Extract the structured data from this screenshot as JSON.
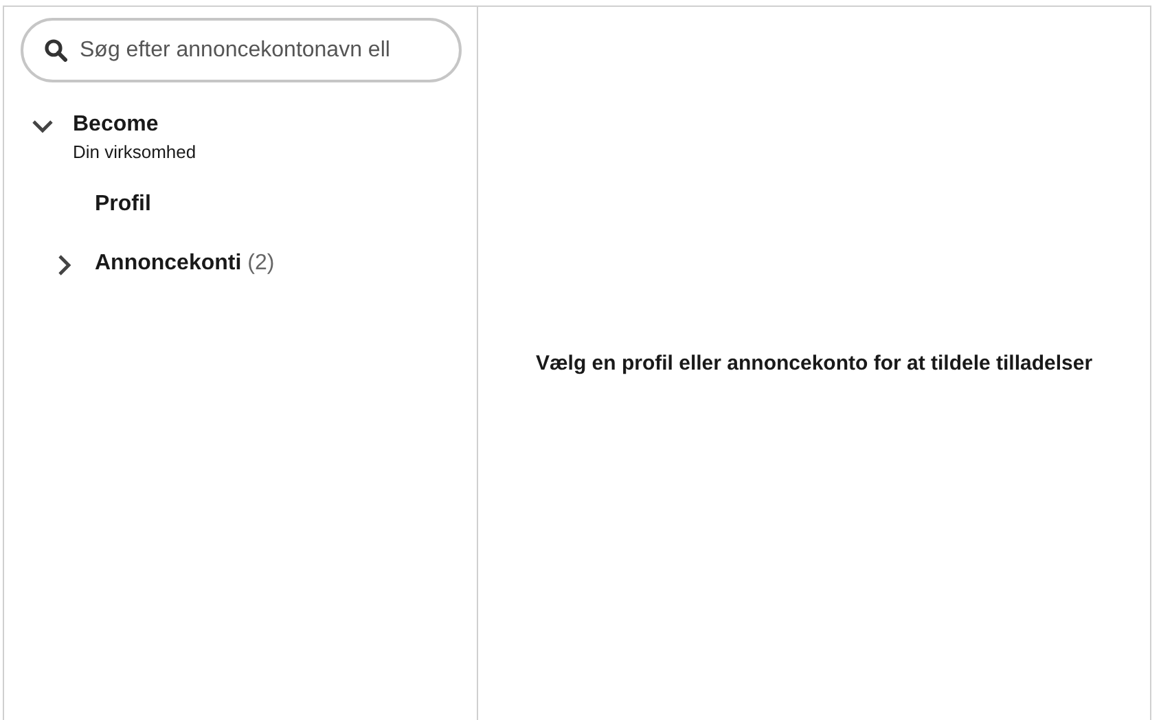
{
  "search": {
    "placeholder": "Søg efter annoncekontonavn ell"
  },
  "tree": [
    {
      "kind": "group",
      "label": "Become",
      "subtitle": "Din virksomhed",
      "expanded": true,
      "children": [
        {
          "kind": "item",
          "label": "Profil"
        },
        {
          "kind": "group",
          "label": "Annoncekonti",
          "count": "(2)",
          "expanded": false
        }
      ]
    }
  ],
  "detail": {
    "message": "Vælg en profil eller annoncekonto for at tildele tilladelser"
  }
}
